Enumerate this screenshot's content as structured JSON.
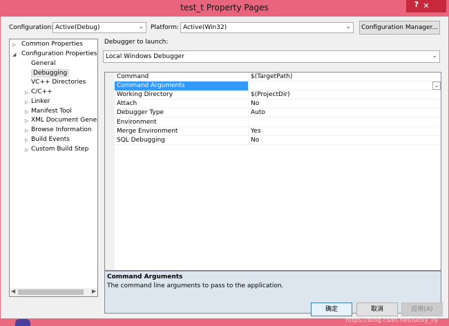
{
  "window": {
    "title": "test_t Property Pages",
    "help_label": "?",
    "close_label": "✕"
  },
  "toolbar": {
    "configuration_label": "Configuration:",
    "configuration_value": "Active(Debug)",
    "platform_label": "Platform:",
    "platform_value": "Active(Win32)",
    "config_manager_label": "Configuration Manager..."
  },
  "tree": {
    "items": [
      {
        "label": "Common Properties",
        "arrow": "▷"
      },
      {
        "label": "Configuration Properties",
        "arrow": "◢"
      },
      {
        "label": "General",
        "arrow": ""
      },
      {
        "label": "Debugging",
        "arrow": ""
      },
      {
        "label": "VC++ Directories",
        "arrow": ""
      },
      {
        "label": "C/C++",
        "arrow": "▷"
      },
      {
        "label": "Linker",
        "arrow": "▷"
      },
      {
        "label": "Manifest Tool",
        "arrow": "▷"
      },
      {
        "label": "XML Document Generat",
        "arrow": "▷"
      },
      {
        "label": "Browse Information",
        "arrow": "▷"
      },
      {
        "label": "Build Events",
        "arrow": "▷"
      },
      {
        "label": "Custom Build Step",
        "arrow": "▷"
      }
    ],
    "selected": "Debugging"
  },
  "debugger": {
    "launch_label": "Debugger to launch:",
    "launch_value": "Local Windows Debugger"
  },
  "grid": {
    "rows": [
      {
        "name": "Command",
        "value": "$(TargetPath)"
      },
      {
        "name": "Command Arguments",
        "value": ""
      },
      {
        "name": "Working Directory",
        "value": "$(ProjectDir)"
      },
      {
        "name": "Attach",
        "value": "No"
      },
      {
        "name": "Debugger Type",
        "value": "Auto"
      },
      {
        "name": "Environment",
        "value": ""
      },
      {
        "name": "Merge Environment",
        "value": "Yes"
      },
      {
        "name": "SQL Debugging",
        "value": "No"
      }
    ],
    "selected_row": "Command Arguments"
  },
  "description": {
    "title": "Command Arguments",
    "text": "The command line arguments to pass to the application."
  },
  "buttons": {
    "ok": "确定",
    "cancel": "取消",
    "apply": "应用(A)"
  },
  "watermark": "https://blog.csdn.net/lucky_lly",
  "icons": {
    "dropdown": "chevron-down-icon",
    "collapsed": "triangle-right-icon",
    "expanded": "triangle-down-icon"
  },
  "colors": {
    "titlebar": "#e8657d",
    "selection": "#3399ff",
    "close": "#c7283c"
  }
}
